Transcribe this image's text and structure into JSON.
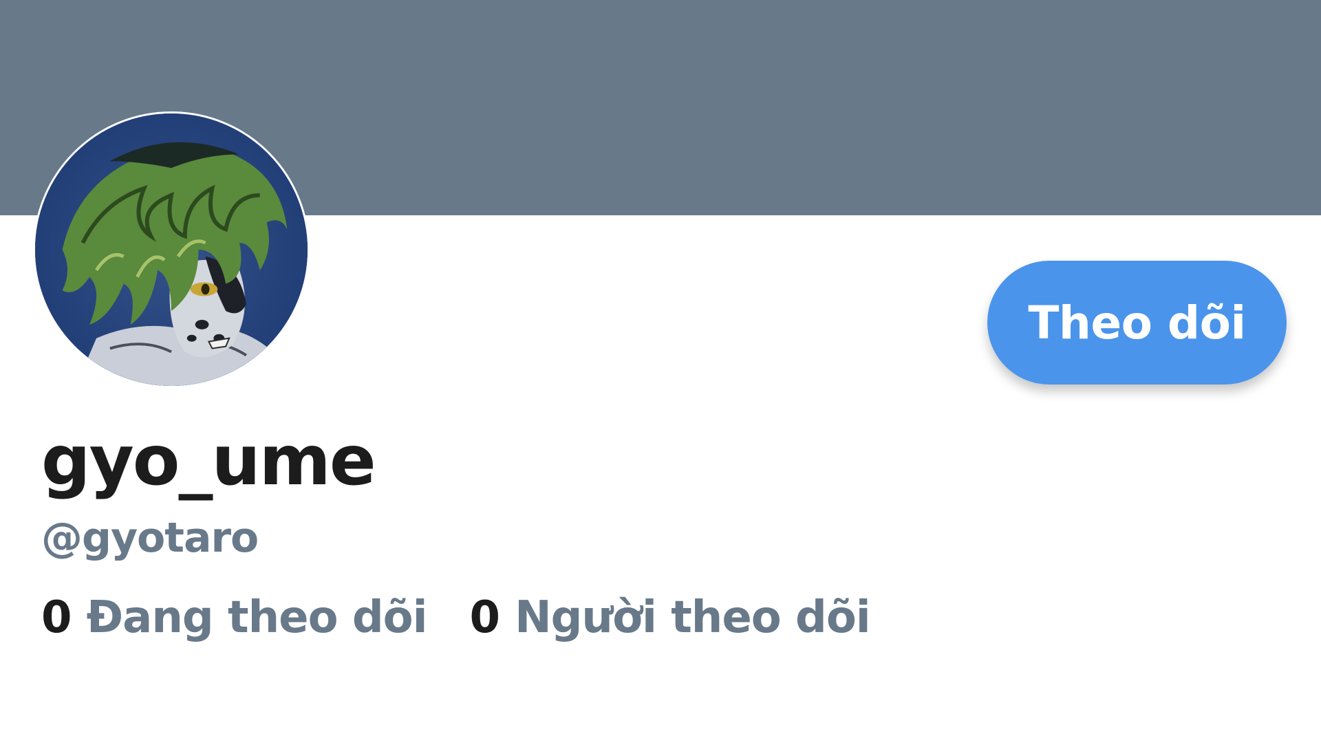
{
  "colors": {
    "banner": "#68798a",
    "accent": "#4b94eb",
    "name_text": "#1c1c1c",
    "secondary_text": "#68798a"
  },
  "profile": {
    "display_name": "gyo_ume",
    "handle": "@gyotaro",
    "avatar_icon": "anime-character-avatar"
  },
  "actions": {
    "follow_label": "Theo dõi"
  },
  "stats": {
    "following_count": "0",
    "following_label": "Đang theo dõi",
    "followers_count": "0",
    "followers_label": "Người theo dõi"
  }
}
